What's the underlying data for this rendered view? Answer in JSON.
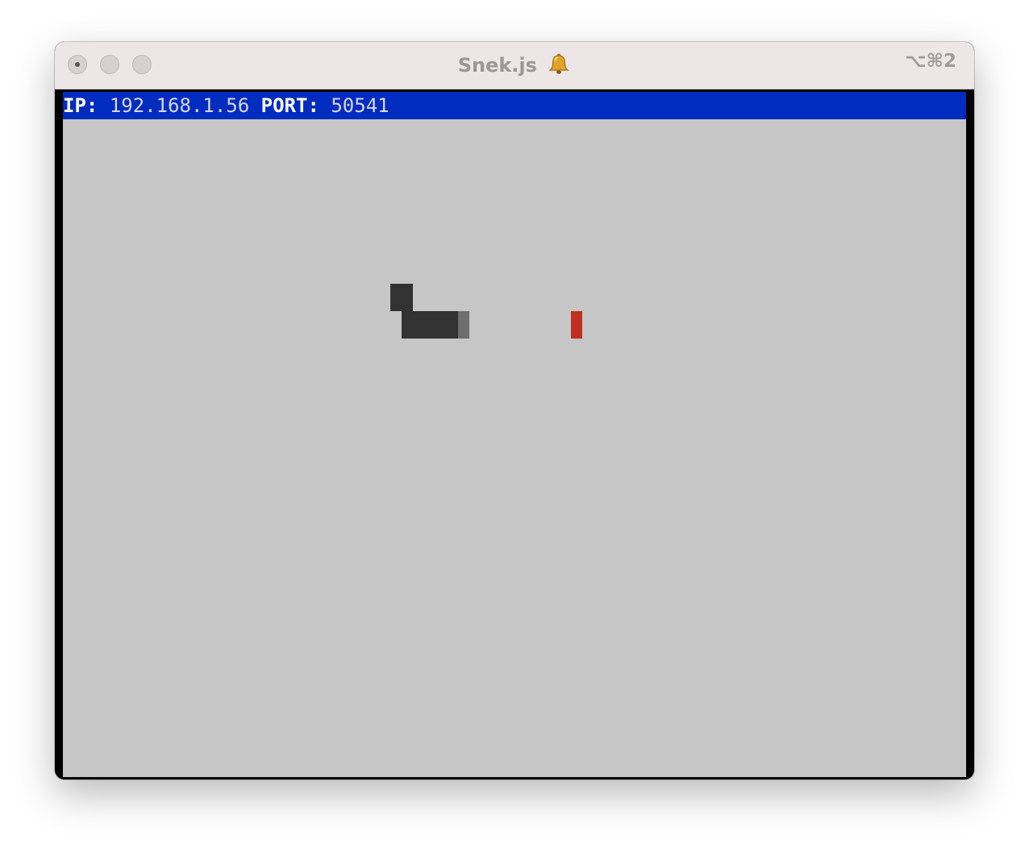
{
  "window": {
    "title": "Snek.js",
    "title_icon": "bell-icon",
    "shortcut": "⌥⌘2"
  },
  "status": {
    "ip_label": "IP:",
    "ip_value": "192.168.1.56",
    "port_label": "PORT:",
    "port_value": "50541"
  },
  "colors": {
    "status_bar": "#002cbf",
    "board": "#c6c6c6",
    "snake": "#323232",
    "snake_tail": "#6e6e6e",
    "apple": "#c03020"
  }
}
